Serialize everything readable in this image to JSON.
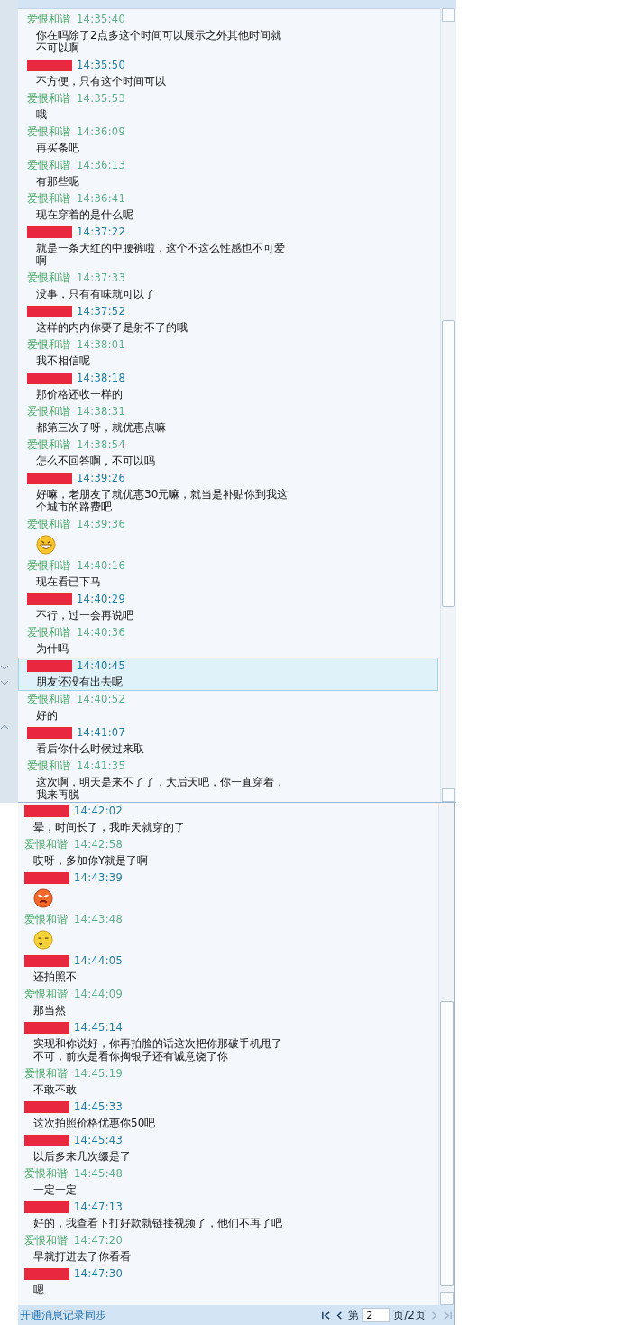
{
  "panels": [
    {
      "messages": [
        {
          "kind": "other",
          "sender": "爱恨和谐",
          "time": "14:35:40",
          "text": "你在吗除了2点多这个时间可以展示之外其他时间就不可以啊",
          "selected": false
        },
        {
          "kind": "self",
          "time": "14:35:50",
          "text": "不方便，只有这个时间可以",
          "selected": false
        },
        {
          "kind": "other",
          "sender": "爱恨和谐",
          "time": "14:35:53",
          "text": "哦",
          "selected": false
        },
        {
          "kind": "other",
          "sender": "爱恨和谐",
          "time": "14:36:09",
          "text": "再买条吧",
          "selected": false
        },
        {
          "kind": "other",
          "sender": "爱恨和谐",
          "time": "14:36:13",
          "text": "有那些呢",
          "selected": false
        },
        {
          "kind": "other",
          "sender": "爱恨和谐",
          "time": "14:36:41",
          "text": "现在穿着的是什么呢",
          "selected": false
        },
        {
          "kind": "self",
          "time": "14:37:22",
          "text": "就是一条大红的中腰裤啦，这个不这么性感也不可爱啊",
          "selected": false
        },
        {
          "kind": "other",
          "sender": "爱恨和谐",
          "time": "14:37:33",
          "text": "没事，只有有味就可以了",
          "selected": false
        },
        {
          "kind": "self",
          "time": "14:37:52",
          "text": "这样的内内你要了是射不了的哦",
          "selected": false
        },
        {
          "kind": "other",
          "sender": "爱恨和谐",
          "time": "14:38:01",
          "text": "我不相信呢",
          "selected": false
        },
        {
          "kind": "self",
          "time": "14:38:18",
          "text": "那价格还收一样的",
          "selected": false
        },
        {
          "kind": "other",
          "sender": "爱恨和谐",
          "time": "14:38:31",
          "text": "都第三次了呀，就优惠点嘛",
          "selected": false
        },
        {
          "kind": "other",
          "sender": "爱恨和谐",
          "time": "14:38:54",
          "text": "怎么不回答啊，不可以吗",
          "selected": false
        },
        {
          "kind": "self",
          "time": "14:39:26",
          "text": "好嘛，老朋友了就优惠30元嘛，就当是补贴你到我这个城市的路费吧",
          "selected": false
        },
        {
          "kind": "other",
          "sender": "爱恨和谐",
          "time": "14:39:36",
          "sticker": {
            "kind": "grin"
          },
          "selected": false
        },
        {
          "kind": "other",
          "sender": "爱恨和谐",
          "time": "14:40:16",
          "text": "现在看已下马",
          "selected": false
        },
        {
          "kind": "self",
          "time": "14:40:29",
          "text": "不行，过一会再说吧",
          "selected": false
        },
        {
          "kind": "other",
          "sender": "爱恨和谐",
          "time": "14:40:36",
          "text": "为什吗",
          "selected": false
        },
        {
          "kind": "self",
          "time": "14:40:45",
          "text": "朋友还没有出去呢",
          "selected": true
        },
        {
          "kind": "other",
          "sender": "爱恨和谐",
          "time": "14:40:52",
          "text": "好的",
          "selected": false
        },
        {
          "kind": "self",
          "time": "14:41:07",
          "text": "看后你什么时候过来取",
          "selected": false
        },
        {
          "kind": "other",
          "sender": "爱恨和谐",
          "time": "14:41:35",
          "text": "这次啊，明天是来不了了，大后天吧，你一直穿着，我来再脱",
          "selected": false
        }
      ]
    },
    {
      "messages": [
        {
          "kind": "self",
          "time": "14:42:02",
          "text": "晕，时间长了，我昨天就穿的了",
          "selected": false
        },
        {
          "kind": "other",
          "sender": "爱恨和谐",
          "time": "14:42:58",
          "text": "哎呀，多加你Y就是了啊",
          "selected": false
        },
        {
          "kind": "self",
          "time": "14:43:39",
          "sticker": {
            "kind": "angry"
          },
          "selected": false
        },
        {
          "kind": "other",
          "sender": "爱恨和谐",
          "time": "14:43:48",
          "sticker": {
            "kind": "sleepy"
          },
          "selected": false
        },
        {
          "kind": "self",
          "time": "14:44:05",
          "text": "还拍照不",
          "selected": false
        },
        {
          "kind": "other",
          "sender": "爱恨和谐",
          "time": "14:44:09",
          "text": "那当然",
          "selected": false
        },
        {
          "kind": "self",
          "time": "14:45:14",
          "text": "实现和你说好，你再拍脸的话这次把你那破手机甩了不可，前次是看你掏银子还有诚意饶了你",
          "selected": false
        },
        {
          "kind": "other",
          "sender": "爱恨和谐",
          "time": "14:45:19",
          "text": "不敢不敢",
          "selected": false
        },
        {
          "kind": "self",
          "time": "14:45:33",
          "text": "这次拍照价格优惠你50吧",
          "selected": false
        },
        {
          "kind": "self",
          "time": "14:45:43",
          "text": "以后多来几次缀是了",
          "selected": false
        },
        {
          "kind": "other",
          "sender": "爱恨和谐",
          "time": "14:45:48",
          "text": "一定一定",
          "selected": false
        },
        {
          "kind": "self",
          "time": "14:47:13",
          "text": "好的，我查看下打好款就链接视频了，他们不再了吧",
          "selected": false
        },
        {
          "kind": "other",
          "sender": "爱恨和谐",
          "time": "14:47:20",
          "text": "早就打进去了你看看",
          "selected": false
        },
        {
          "kind": "self",
          "time": "14:47:30",
          "text": "嗯",
          "selected": false
        }
      ],
      "footer": {
        "sync_link": "开通消息记录同步",
        "page_prefix": "第",
        "page_value": "2",
        "page_suffix": "页/2页"
      }
    }
  ]
}
